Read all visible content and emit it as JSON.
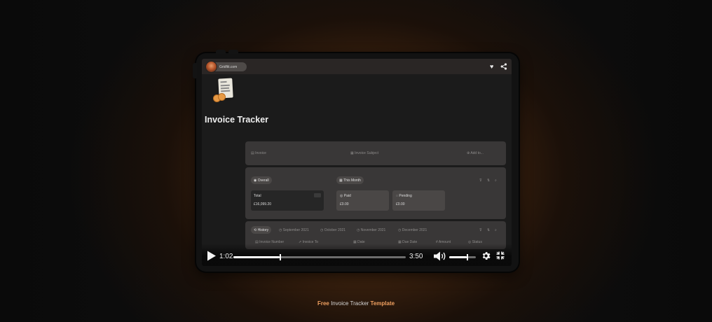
{
  "player": {
    "creator_name": "Gridfiti.com",
    "current_time": "1:02",
    "duration": "3:50",
    "progress": 0.27,
    "volume": 0.65
  },
  "page": {
    "title": "Invoice Tracker",
    "toolbar": {
      "invoice_label": "Invoice",
      "invoice_subject_label": "Invoice Subject",
      "add_label": "Add to..."
    },
    "summary": {
      "tab_overall": "Overall",
      "tab_this_month": "This Month",
      "total_label": "Total",
      "total_value": "£16,099.20",
      "paid_label": "Paid",
      "paid_value": "£0.00",
      "pending_label": "Pending",
      "pending_value": "£0.00"
    },
    "history": {
      "tabs": [
        "History",
        "September 2021",
        "October 2021",
        "November 2021",
        "December 2021"
      ],
      "columns": [
        "Invoice Number",
        "Invoice To",
        "Date",
        "Due Date",
        "Amount",
        "Status"
      ]
    }
  },
  "footer": {
    "prefix": "Free",
    "middle": " Invoice Tracker ",
    "suffix": "Template"
  },
  "colors": {
    "accent": "#f0a060",
    "background": "#1b1b1b"
  }
}
